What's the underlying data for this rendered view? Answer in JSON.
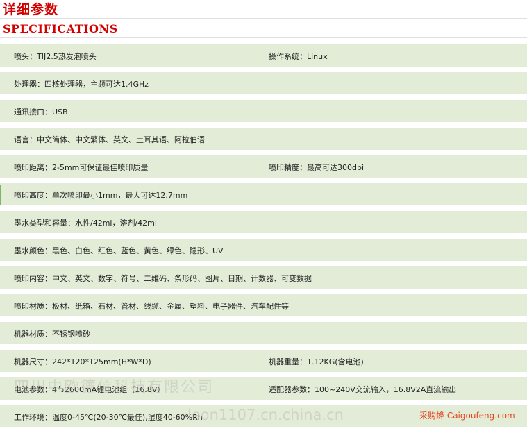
{
  "header": {
    "title_cn": "详细参数",
    "title_en": "SPECIFICATIONS"
  },
  "specs": [
    {
      "left": "喷头：TIJ2.5热发泡喷头",
      "right": "操作系统：Linux"
    },
    {
      "left": "处理器：四核处理器，主频可达1.4GHz",
      "right": ""
    },
    {
      "left": "通讯接口：USB",
      "right": ""
    },
    {
      "left": "语言：中文简体、中文繁体、英文、土耳其语、阿拉伯语",
      "right": ""
    },
    {
      "left": "喷印距离：2-5mm可保证最佳喷印质量",
      "right": "喷印精度：最高可达300dpi"
    },
    {
      "left": "喷印高度：单次喷印最小1mm，最大可达12.7mm",
      "right": ""
    },
    {
      "left": "墨水类型和容量：水性/42ml，溶剂/42ml",
      "right": ""
    },
    {
      "left": "墨水颜色：黑色、白色、红色、蓝色、黄色、绿色、隐形、UV",
      "right": ""
    },
    {
      "left": "喷印内容：中文、英文、数字、符号、二维码、条形码、图片、日期、计数器、可变数据",
      "right": ""
    },
    {
      "left": "喷印材质：板材、纸箱、石材、管材、线缆、金属、塑料、电子器件、汽车配件等",
      "right": ""
    },
    {
      "left": "机器材质：不锈钢喷砂",
      "right": ""
    },
    {
      "left": "机器尺寸：242*120*125mm(H*W*D)",
      "right": "机器重量：1.12KG(含电池)"
    },
    {
      "left": "电池参数：4节2600mA锂电池组（16.8V）",
      "right": "适配器参数：100~240V交流输入，16.8V2A直流输出"
    },
    {
      "left": "工作环境：温度0-45℃(20-30℃最佳),湿度40-60%Rh",
      "right": ""
    }
  ],
  "watermarks": {
    "company": "四川中欧德信科技有限公司",
    "site": "leon1107.cn.china.cn",
    "brand": "采购蜂 Caigoufeng.com"
  }
}
